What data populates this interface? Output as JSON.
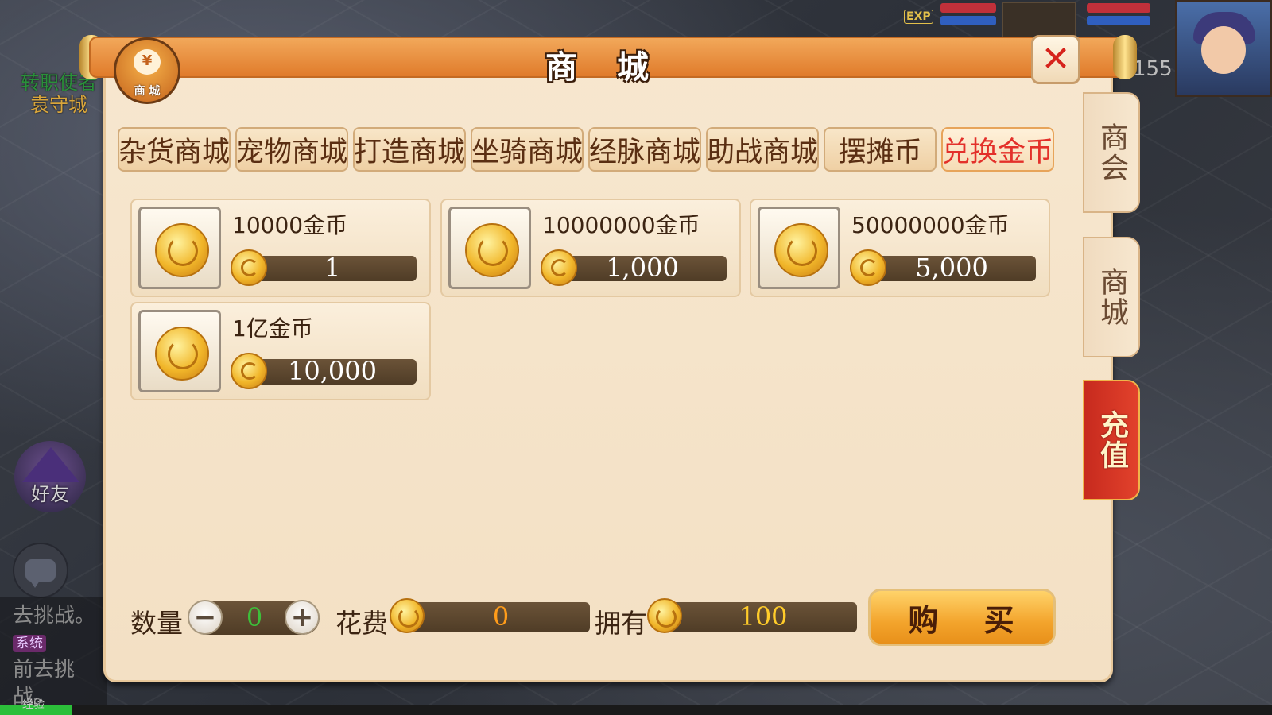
{
  "hud": {
    "npc_name": "转职使者",
    "npc_location": "袁守城",
    "level": "155",
    "exp_tag": "EXP",
    "friend_label": "好友",
    "chat_lines": [
      "去挑战。",
      "前去挑战。"
    ],
    "chat_sys_tag": "系统",
    "exp_label": "经验"
  },
  "panel": {
    "title": "商 城",
    "badge_text": "商 城",
    "badge_symbol": "¥",
    "close_symbol": "✕"
  },
  "tabs": [
    {
      "label": "杂货商城",
      "active": false
    },
    {
      "label": "宠物商城",
      "active": false
    },
    {
      "label": "打造商城",
      "active": false
    },
    {
      "label": "坐骑商城",
      "active": false
    },
    {
      "label": "经脉商城",
      "active": false
    },
    {
      "label": "助战商城",
      "active": false
    },
    {
      "label": "摆摊币",
      "active": false
    },
    {
      "label": "兑换金币",
      "active": true
    }
  ],
  "items": [
    {
      "name": "10000金币",
      "price": "1",
      "icon": "gold-coin-icon"
    },
    {
      "name": "10000000金币",
      "price": "1,000",
      "icon": "gold-coin-icon"
    },
    {
      "name": "50000000金币",
      "price": "5,000",
      "icon": "gold-coin-icon"
    },
    {
      "name": "1亿金币",
      "price": "10,000",
      "icon": "gold-coin-icon"
    }
  ],
  "footer": {
    "quantity_label": "数量",
    "quantity_value": "0",
    "minus_symbol": "−",
    "plus_symbol": "+",
    "cost_label": "花费",
    "cost_value": "0",
    "own_label": "拥有",
    "own_value": "100",
    "buy_label": "购 买"
  },
  "side_tabs": [
    {
      "label": "商会"
    },
    {
      "label": "商城"
    },
    {
      "label": "充值"
    }
  ],
  "colors": {
    "active_tab": "#e3302a",
    "quantity": "#3dbf3a",
    "cost": "#ff9c1a",
    "own": "#ffcc2a",
    "recharge_tab": "#d2321f"
  }
}
